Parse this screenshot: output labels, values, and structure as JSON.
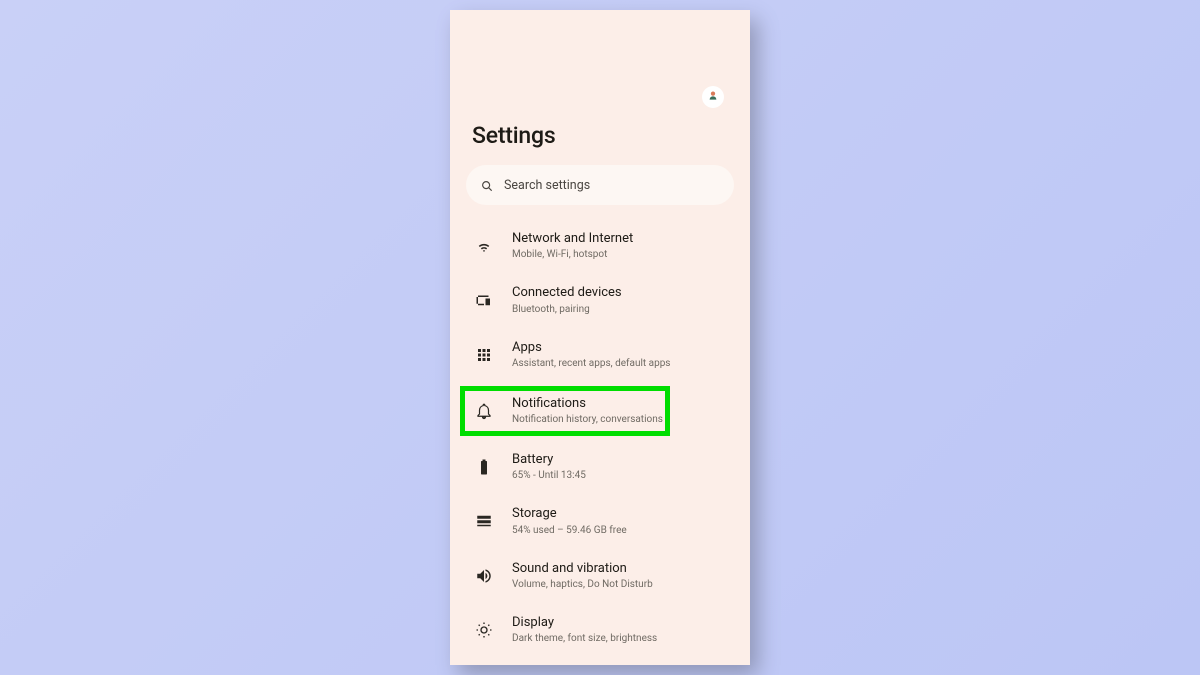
{
  "header": {
    "title": "Settings"
  },
  "search": {
    "placeholder": "Search settings"
  },
  "items": [
    {
      "id": "network",
      "title": "Network and Internet",
      "subtitle": "Mobile, Wi-Fi, hotspot"
    },
    {
      "id": "devices",
      "title": "Connected devices",
      "subtitle": "Bluetooth, pairing"
    },
    {
      "id": "apps",
      "title": "Apps",
      "subtitle": "Assistant, recent apps, default apps"
    },
    {
      "id": "notif",
      "title": "Notifications",
      "subtitle": "Notification history, conversations",
      "highlighted": true
    },
    {
      "id": "battery",
      "title": "Battery",
      "subtitle": "65% - Until 13:45"
    },
    {
      "id": "storage",
      "title": "Storage",
      "subtitle": "54% used – 59.46 GB free"
    },
    {
      "id": "sound",
      "title": "Sound and vibration",
      "subtitle": "Volume, haptics, Do Not Disturb"
    },
    {
      "id": "display",
      "title": "Display",
      "subtitle": "Dark theme, font size, brightness"
    }
  ]
}
